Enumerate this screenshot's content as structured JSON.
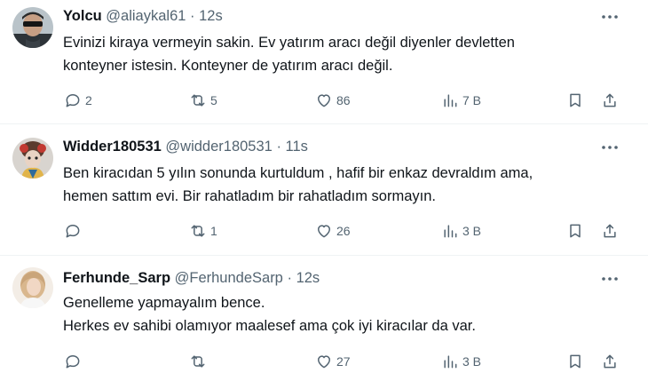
{
  "tweets": [
    {
      "display_name": "Yolcu",
      "handle": "@aliaykal61",
      "separator": "·",
      "time": "12s",
      "lines": [
        "Evinizi kiraya vermeyin sakin. Ev yatırım aracı değil diyenler devletten",
        "konteyner istesin. Konteyner de yatırım aracı değil."
      ],
      "replies": "2",
      "retweets": "5",
      "likes": "86",
      "views": "7 B"
    },
    {
      "display_name": "Widder180531",
      "handle": "@widder180531",
      "separator": "·",
      "time": "11s",
      "lines": [
        "Ben kiracıdan 5 yılın sonunda kurtuldum , hafif bir enkaz devraldım ama,",
        "hemen sattım evi. Bir rahatladım bir rahatladım sormayın."
      ],
      "replies": "",
      "retweets": "1",
      "likes": "26",
      "views": "3 B"
    },
    {
      "display_name": "Ferhunde_Sarp",
      "handle": "@FerhundeSarp",
      "separator": "·",
      "time": "12s",
      "lines": [
        "Genelleme yapmayalım bence.",
        "Herkes ev sahibi olamıyor maalesef ama çok iyi kiracılar da var."
      ],
      "replies": "",
      "retweets": "",
      "likes": "27",
      "views": "3 B"
    }
  ],
  "icons": {
    "reply": "reply-icon",
    "retweet": "retweet-icon",
    "like": "heart-icon",
    "views": "views-chart-icon",
    "bookmark": "bookmark-icon",
    "share": "share-icon",
    "more": "more-dots-icon"
  },
  "colors": {
    "text": "#0f1419",
    "secondary": "#536471",
    "divider": "#eff3f4"
  }
}
